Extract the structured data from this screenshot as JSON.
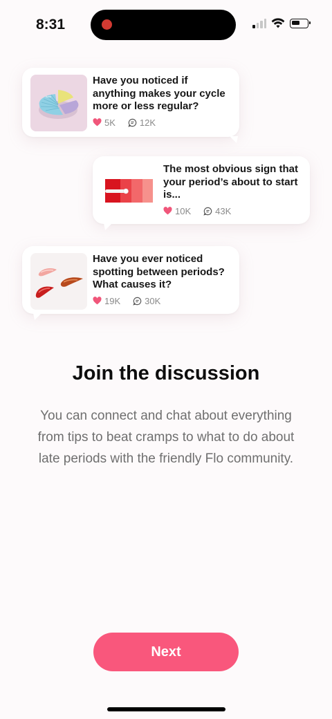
{
  "status_bar": {
    "time": "8:31",
    "recording_color": "#d23a32",
    "icons": [
      "signal-icon",
      "wifi-icon",
      "battery-icon"
    ]
  },
  "cards": [
    {
      "question": "Have you noticed if anything makes your cycle more or less regular?",
      "likes": "5K",
      "comments": "12K",
      "thumbnail": "pie-chart-illustration"
    },
    {
      "question": "The most obvious sign that your period’s about to start is...",
      "likes": "10K",
      "comments": "43K",
      "thumbnail": "red-color-swatches-illustration"
    },
    {
      "question": "Have you ever noticed spotting between periods? What causes it?",
      "likes": "19K",
      "comments": "30K",
      "thumbnail": "red-brush-strokes-illustration"
    }
  ],
  "heading": "Join the discussion",
  "body": "You can connect and chat about everything from tips to beat cramps to what to do about late periods with the friendly Flo community.",
  "next_button": {
    "label": "Next"
  },
  "colors": {
    "accent": "#f9577c",
    "heart": "#f0567a",
    "background": "#fdfafb"
  }
}
